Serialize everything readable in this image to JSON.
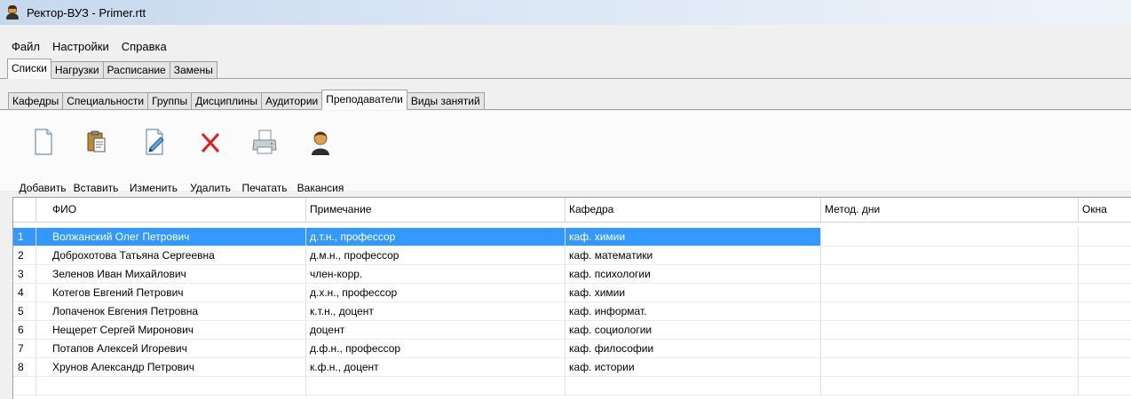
{
  "window": {
    "title": "Ректор-ВУЗ - Primer.rtt"
  },
  "menu": [
    "Файл",
    "Настройки",
    "Справка"
  ],
  "main_tabs": [
    {
      "label": "Списки",
      "active": true
    },
    {
      "label": "Нагрузки",
      "active": false
    },
    {
      "label": "Расписание",
      "active": false
    },
    {
      "label": "Замены",
      "active": false
    }
  ],
  "sub_tabs": [
    {
      "label": "Кафедры",
      "active": false
    },
    {
      "label": "Специальности",
      "active": false
    },
    {
      "label": "Группы",
      "active": false
    },
    {
      "label": "Дисциплины",
      "active": false
    },
    {
      "label": "Аудитории",
      "active": false
    },
    {
      "label": "Преподаватели",
      "active": true
    },
    {
      "label": "Виды занятий",
      "active": false
    }
  ],
  "toolbar": {
    "add": {
      "label": "Добавить",
      "icon": "new-document-icon"
    },
    "paste": {
      "label": "Вставить",
      "icon": "paste-icon"
    },
    "edit": {
      "label": "Изменить",
      "icon": "edit-document-icon"
    },
    "delete": {
      "label": "Удалить",
      "icon": "red-x-icon"
    },
    "print": {
      "label": "Печатать",
      "icon": "printer-icon"
    },
    "vacancy": {
      "label": "Вакансия",
      "icon": "person-icon"
    }
  },
  "table": {
    "columns": [
      "",
      "ФИО",
      "Примечание",
      "Кафедра",
      "Метод. дни",
      "Окна"
    ],
    "selected_row": 0,
    "selection_color": "#3399ff",
    "rows": [
      [
        "1",
        "Волжанский Олег Петрович",
        "д.т.н., профессор",
        "каф. химии",
        "",
        ""
      ],
      [
        "2",
        "Доброхотова Татьяна Сергеевна",
        "д.м.н., профессор",
        "каф. математики",
        "",
        ""
      ],
      [
        "3",
        "Зеленов Иван Михайлович",
        "член-корр.",
        "каф. психологии",
        "",
        ""
      ],
      [
        "4",
        "Котегов Евгений Петрович",
        "д.х.н., профессор",
        "каф. химии",
        "",
        ""
      ],
      [
        "5",
        "Лопаченок Евгения Петровна",
        "к.т.н., доцент",
        "каф. информат.",
        "",
        ""
      ],
      [
        "6",
        "Нещерет Сергей Миронович",
        "доцент",
        "каф. социологии",
        "",
        ""
      ],
      [
        "7",
        "Потапов Алексей Игоревич",
        "д.ф.н., профессор",
        "каф. философии",
        "",
        ""
      ],
      [
        "8",
        "Хрунов Александр Петрович",
        "к.ф.н., доцент",
        "каф. истории",
        "",
        ""
      ]
    ]
  }
}
